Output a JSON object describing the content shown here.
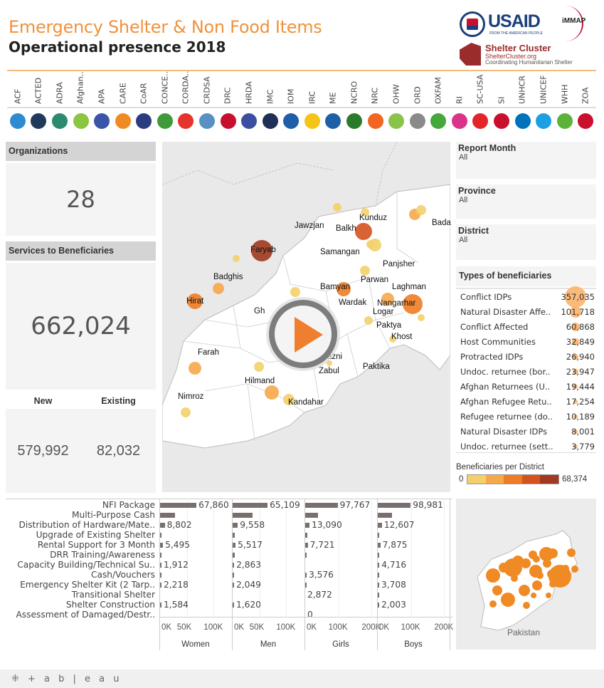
{
  "header": {
    "title": "Emergency Shelter & Non Food Items",
    "subtitle": "Operational presence 2018",
    "logos": {
      "usaid": "USAID",
      "usaid_tagline": "FROM THE AMERICAN PEOPLE",
      "immap": "iMMAP",
      "shelter_cluster": "Shelter Cluster",
      "shelter_cluster_url": "ShelterCluster.org",
      "shelter_cluster_tagline": "Coordinating Humanitarian Shelter"
    }
  },
  "organizations": [
    {
      "name": "ACF",
      "color": "#2e8bd0"
    },
    {
      "name": "ACTED",
      "color": "#1f3b5c"
    },
    {
      "name": "ADRA",
      "color": "#2c8a6e"
    },
    {
      "name": "Afghan..",
      "color": "#8ac640"
    },
    {
      "name": "APA",
      "color": "#3a55a8"
    },
    {
      "name": "CARE",
      "color": "#f08a24"
    },
    {
      "name": "CoAR",
      "color": "#2b3b80"
    },
    {
      "name": "CONCE..",
      "color": "#3e9a3a"
    },
    {
      "name": "CORDA..",
      "color": "#e4342b"
    },
    {
      "name": "CRDSA",
      "color": "#5a8fc4"
    },
    {
      "name": "DRC",
      "color": "#c8102e"
    },
    {
      "name": "HRDA",
      "color": "#3a4fa0"
    },
    {
      "name": "IMC",
      "color": "#1f2f55"
    },
    {
      "name": "IOM",
      "color": "#1f5fa8"
    },
    {
      "name": "IRC",
      "color": "#f6c417"
    },
    {
      "name": "ME",
      "color": "#1f5fa8"
    },
    {
      "name": "NCRO",
      "color": "#2c7a2c"
    },
    {
      "name": "NRC",
      "color": "#f26522"
    },
    {
      "name": "OHW",
      "color": "#8bc34a"
    },
    {
      "name": "ORD",
      "color": "#8a8a8a"
    },
    {
      "name": "OXFAM",
      "color": "#44a83b"
    },
    {
      "name": "RI",
      "color": "#d9338a"
    },
    {
      "name": "SC-USA",
      "color": "#e4242b"
    },
    {
      "name": "SI",
      "color": "#c8102e"
    },
    {
      "name": "UNHCR",
      "color": "#0072bc"
    },
    {
      "name": "UNICEF",
      "color": "#1ca0e3"
    },
    {
      "name": "WHH",
      "color": "#5cb33a"
    },
    {
      "name": "ZOA",
      "color": "#c8102e"
    }
  ],
  "kpis": {
    "organizations_label": "Organizations",
    "organizations_value": "28",
    "services_label": "Services to Beneficiaries",
    "services_value": "662,024",
    "new_label": "New",
    "existing_label": "Existing",
    "new_value": "579,992",
    "existing_value": "82,032"
  },
  "filters": {
    "report_month": {
      "label": "Report Month",
      "value": "All"
    },
    "province": {
      "label": "Province",
      "value": "All"
    },
    "district": {
      "label": "District",
      "value": "All"
    }
  },
  "beneficiary_types": {
    "title": "Types of beneficiaries",
    "rows": [
      {
        "name": "Conflict IDPs",
        "value": "357,035",
        "n": 357035
      },
      {
        "name": "Natural Disaster Affe..",
        "value": "101,718",
        "n": 101718
      },
      {
        "name": "Conflict Affected",
        "value": "60,868",
        "n": 60868
      },
      {
        "name": "Host Communities",
        "value": "32,849",
        "n": 32849
      },
      {
        "name": "Protracted IDPs",
        "value": "26,940",
        "n": 26940
      },
      {
        "name": "Undoc. returnee (bor..",
        "value": "23,947",
        "n": 23947
      },
      {
        "name": "Afghan Returnees (U..",
        "value": "19,444",
        "n": 19444
      },
      {
        "name": "Afghan Refugee Retu..",
        "value": "17,254",
        "n": 17254
      },
      {
        "name": "Refugee returnee (do..",
        "value": "10,189",
        "n": 10189
      },
      {
        "name": "Natural Disaster IDPs",
        "value": "8,001",
        "n": 8001
      },
      {
        "name": "Undoc. returnee (sett..",
        "value": "3,779",
        "n": 3779
      }
    ]
  },
  "legend": {
    "title": "Beneficiaries per District",
    "min": "0",
    "max": "68,374",
    "colors": [
      "#f3d06b",
      "#f6a94a",
      "#ee7c25",
      "#d4531f",
      "#a0391f"
    ]
  },
  "map": {
    "provinces": [
      "Jawzjan",
      "Balkh",
      "Kunduz",
      "Bada",
      "Faryab",
      "Samangan",
      "Panjsher",
      "Badghis",
      "Parwan",
      "Laghman",
      "Bamyan",
      "Wardak",
      "Hirat",
      "Nangarhar",
      "Gh",
      "Logar",
      "Paktya",
      "azni",
      "Khost",
      "Farah",
      "Zabul",
      "Paktika",
      "Hilmand",
      "Nimroz",
      "Kandahar"
    ],
    "play_button": "play-video"
  },
  "minimap": {
    "label": "Pakistan"
  },
  "chart_data": {
    "type": "bar",
    "title": "",
    "categories": [
      "NFI Package",
      "Multi-Purpose Cash",
      "Distribution of Hardware/Mate..",
      "Upgrade of Existing Shelter",
      "Rental Support for 3 Month",
      "DRR Training/Awareness",
      "Capacity Building/Technical Su..",
      "Cash/Vouchers",
      "Emergency Shelter Kit (2 Tarp..",
      "Transitional Shelter",
      "Shelter Construction",
      "Assessment of Damaged/Destr.."
    ],
    "series": [
      {
        "name": "Women",
        "axis_max": 130000,
        "ticks": [
          "0K",
          "50K",
          "100K"
        ],
        "tick_values": [
          0,
          50000,
          100000
        ],
        "values": [
          67860,
          28000,
          8802,
          2000,
          5495,
          2000,
          1912,
          800,
          2218,
          0,
          1584,
          0
        ],
        "labels": [
          "67,860",
          "",
          "8,802",
          "",
          "5,495",
          "",
          "1,912",
          "",
          "2,218",
          "",
          "1,584",
          ""
        ]
      },
      {
        "name": "Men",
        "axis_max": 130000,
        "ticks": [
          "0K",
          "50K",
          "100K"
        ],
        "tick_values": [
          0,
          50000,
          100000
        ],
        "values": [
          65109,
          37000,
          9558,
          4000,
          5517,
          4000,
          2863,
          800,
          2049,
          0,
          1620,
          0
        ],
        "labels": [
          "65,109",
          "",
          "9,558",
          "",
          "5,517",
          "",
          "2,863",
          "",
          "2,049",
          "",
          "1,620",
          ""
        ]
      },
      {
        "name": "Girls",
        "axis_max": 210000,
        "ticks": [
          "0K",
          "100K",
          "200K"
        ],
        "tick_values": [
          0,
          100000,
          200000
        ],
        "values": [
          97767,
          38000,
          13090,
          7000,
          7721,
          1000,
          0,
          1000,
          1000,
          0,
          0,
          0
        ],
        "labels": [
          "97,767",
          "",
          "13,090",
          "",
          "7,721",
          "",
          "",
          "3,576",
          "",
          "2,872",
          "",
          "0"
        ]
      },
      {
        "name": "Boys",
        "axis_max": 210000,
        "ticks": [
          "0K",
          "100K",
          "200K"
        ],
        "tick_values": [
          0,
          100000,
          200000
        ],
        "values": [
          98981,
          42000,
          12607,
          4000,
          7875,
          1000,
          4716,
          1000,
          3708,
          1000,
          2003,
          0
        ],
        "labels": [
          "98,981",
          "",
          "12,607",
          "",
          "7,875",
          "",
          "4,716",
          "",
          "3,708",
          "",
          "2,003",
          ""
        ]
      }
    ],
    "xlabel": "",
    "ylabel": ""
  },
  "footer": {
    "brand": "+ a b | e a u"
  }
}
